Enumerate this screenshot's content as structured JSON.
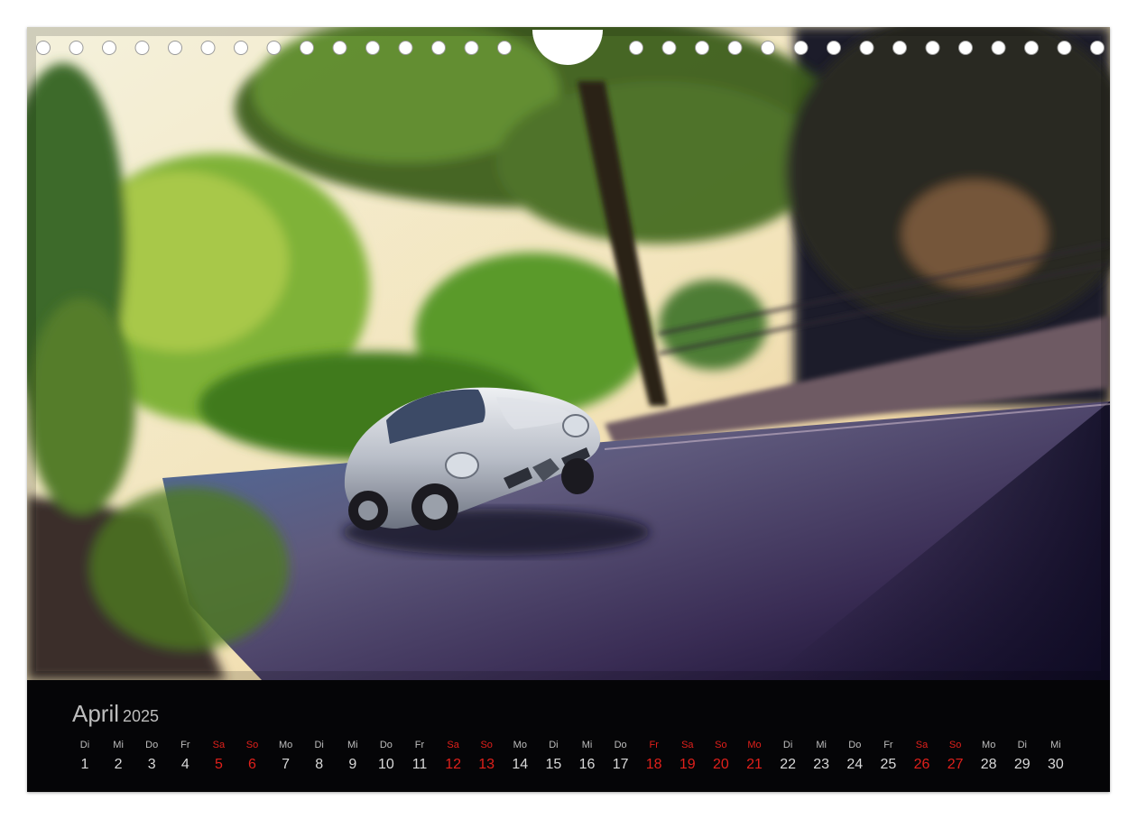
{
  "calendar": {
    "month": "April",
    "year": "2025",
    "days": [
      {
        "wd": "Di",
        "d": "1",
        "red": false
      },
      {
        "wd": "Mi",
        "d": "2",
        "red": false
      },
      {
        "wd": "Do",
        "d": "3",
        "red": false
      },
      {
        "wd": "Fr",
        "d": "4",
        "red": false
      },
      {
        "wd": "Sa",
        "d": "5",
        "red": true
      },
      {
        "wd": "So",
        "d": "6",
        "red": true
      },
      {
        "wd": "Mo",
        "d": "7",
        "red": false
      },
      {
        "wd": "Di",
        "d": "8",
        "red": false
      },
      {
        "wd": "Mi",
        "d": "9",
        "red": false
      },
      {
        "wd": "Do",
        "d": "10",
        "red": false
      },
      {
        "wd": "Fr",
        "d": "11",
        "red": false
      },
      {
        "wd": "Sa",
        "d": "12",
        "red": true
      },
      {
        "wd": "So",
        "d": "13",
        "red": true
      },
      {
        "wd": "Mo",
        "d": "14",
        "red": false
      },
      {
        "wd": "Di",
        "d": "15",
        "red": false
      },
      {
        "wd": "Mi",
        "d": "16",
        "red": false
      },
      {
        "wd": "Do",
        "d": "17",
        "red": false
      },
      {
        "wd": "Fr",
        "d": "18",
        "red": true
      },
      {
        "wd": "Sa",
        "d": "19",
        "red": true
      },
      {
        "wd": "So",
        "d": "20",
        "red": true
      },
      {
        "wd": "Mo",
        "d": "21",
        "red": true
      },
      {
        "wd": "Di",
        "d": "22",
        "red": false
      },
      {
        "wd": "Mi",
        "d": "23",
        "red": false
      },
      {
        "wd": "Do",
        "d": "24",
        "red": false
      },
      {
        "wd": "Fr",
        "d": "25",
        "red": false
      },
      {
        "wd": "Sa",
        "d": "26",
        "red": true
      },
      {
        "wd": "So",
        "d": "27",
        "red": true
      },
      {
        "wd": "Mo",
        "d": "28",
        "red": false
      },
      {
        "wd": "Di",
        "d": "29",
        "red": false
      },
      {
        "wd": "Mi",
        "d": "30",
        "red": false
      }
    ]
  },
  "photo": {
    "subject": "car-icon",
    "colors": {
      "accent_red": "#e0201b",
      "car_silver": "#c9ccd2",
      "foliage": "#6fae2e"
    }
  }
}
